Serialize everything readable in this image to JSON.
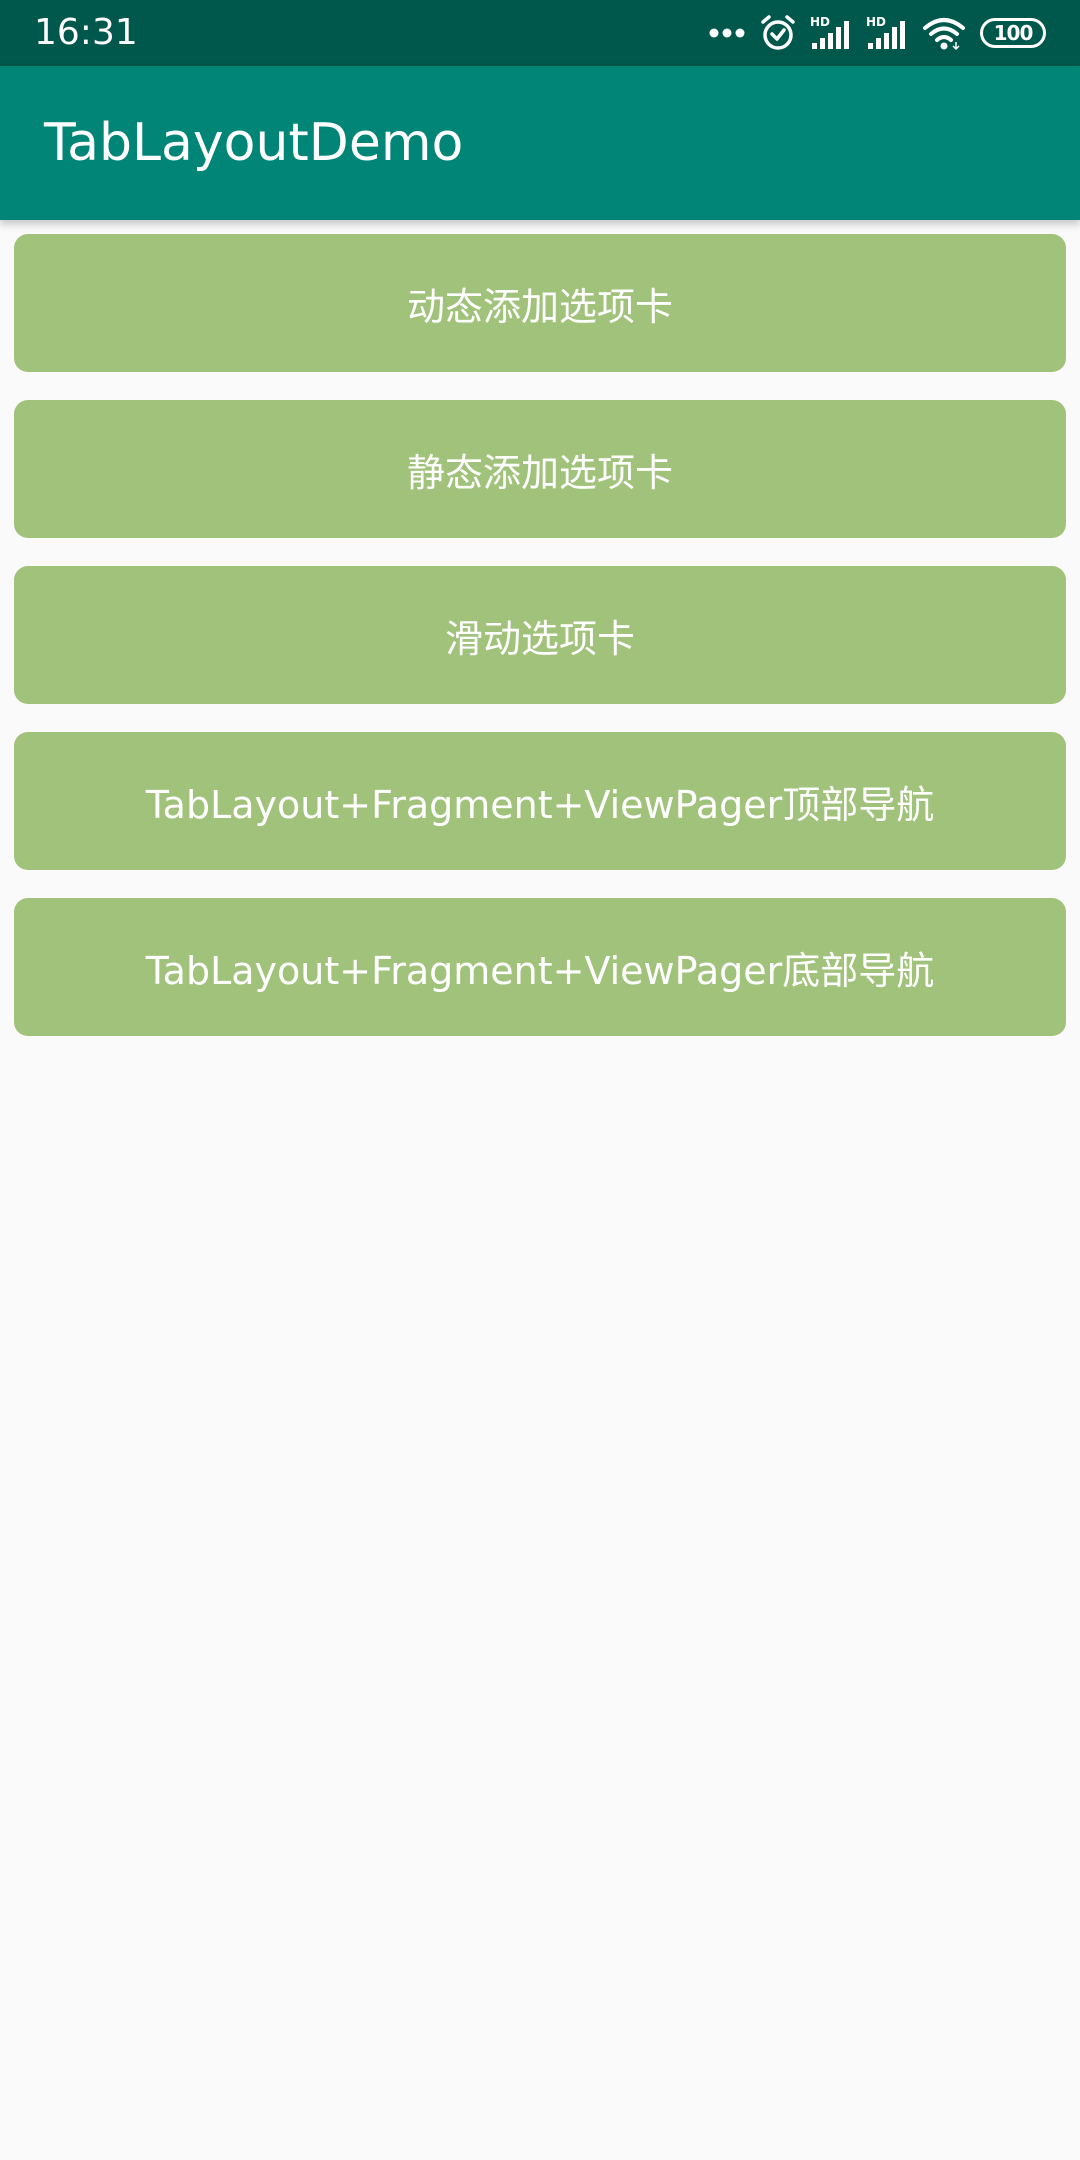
{
  "status_bar": {
    "time": "16:31",
    "battery_level": "100",
    "icons": [
      "more-dots-icon",
      "alarm-icon",
      "hd-signal-icon",
      "hd-signal-icon",
      "wifi-icon",
      "battery-icon"
    ]
  },
  "app_bar": {
    "title": "TabLayoutDemo"
  },
  "buttons": [
    {
      "label": "动态添加选项卡"
    },
    {
      "label": "静态添加选项卡"
    },
    {
      "label": "滑动选项卡"
    },
    {
      "label": "TabLayout+Fragment+ViewPager顶部导航"
    },
    {
      "label": "TabLayout+Fragment+ViewPager底部导航"
    }
  ],
  "colors": {
    "status_bar": "#00574b",
    "app_bar": "#008577",
    "button": "#a0c27a",
    "background": "#fafafa"
  }
}
